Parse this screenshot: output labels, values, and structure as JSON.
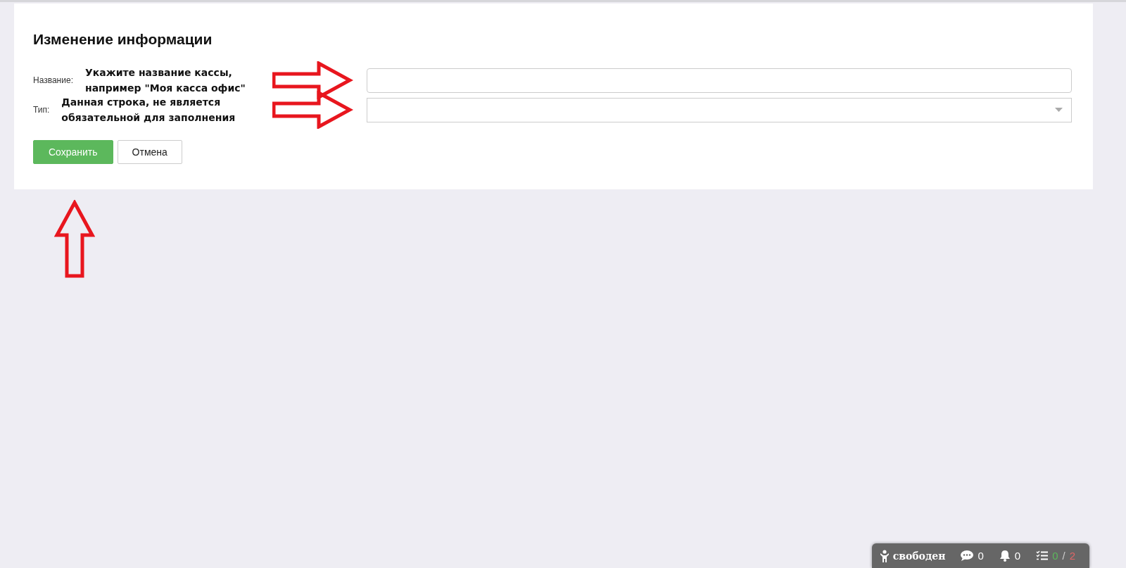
{
  "form": {
    "title": "Изменение информации",
    "fields": [
      {
        "kind": "text",
        "label": "Название:",
        "annotation": "Укажите название кассы,\nнапример \"Моя касса офис\""
      },
      {
        "kind": "select",
        "label": "Тип:",
        "annotation": "Данная строка, не является\nобязательной для заполнения"
      }
    ],
    "buttons": [
      {
        "kind": "primary",
        "label": "Сохранить"
      },
      {
        "kind": "default",
        "label": "Отмена"
      }
    ]
  },
  "status_bar": {
    "status": "свободен",
    "messages": "0",
    "notifications": "0",
    "tasks_done": "0",
    "tasks_separator": "/",
    "tasks_total": "2"
  }
}
